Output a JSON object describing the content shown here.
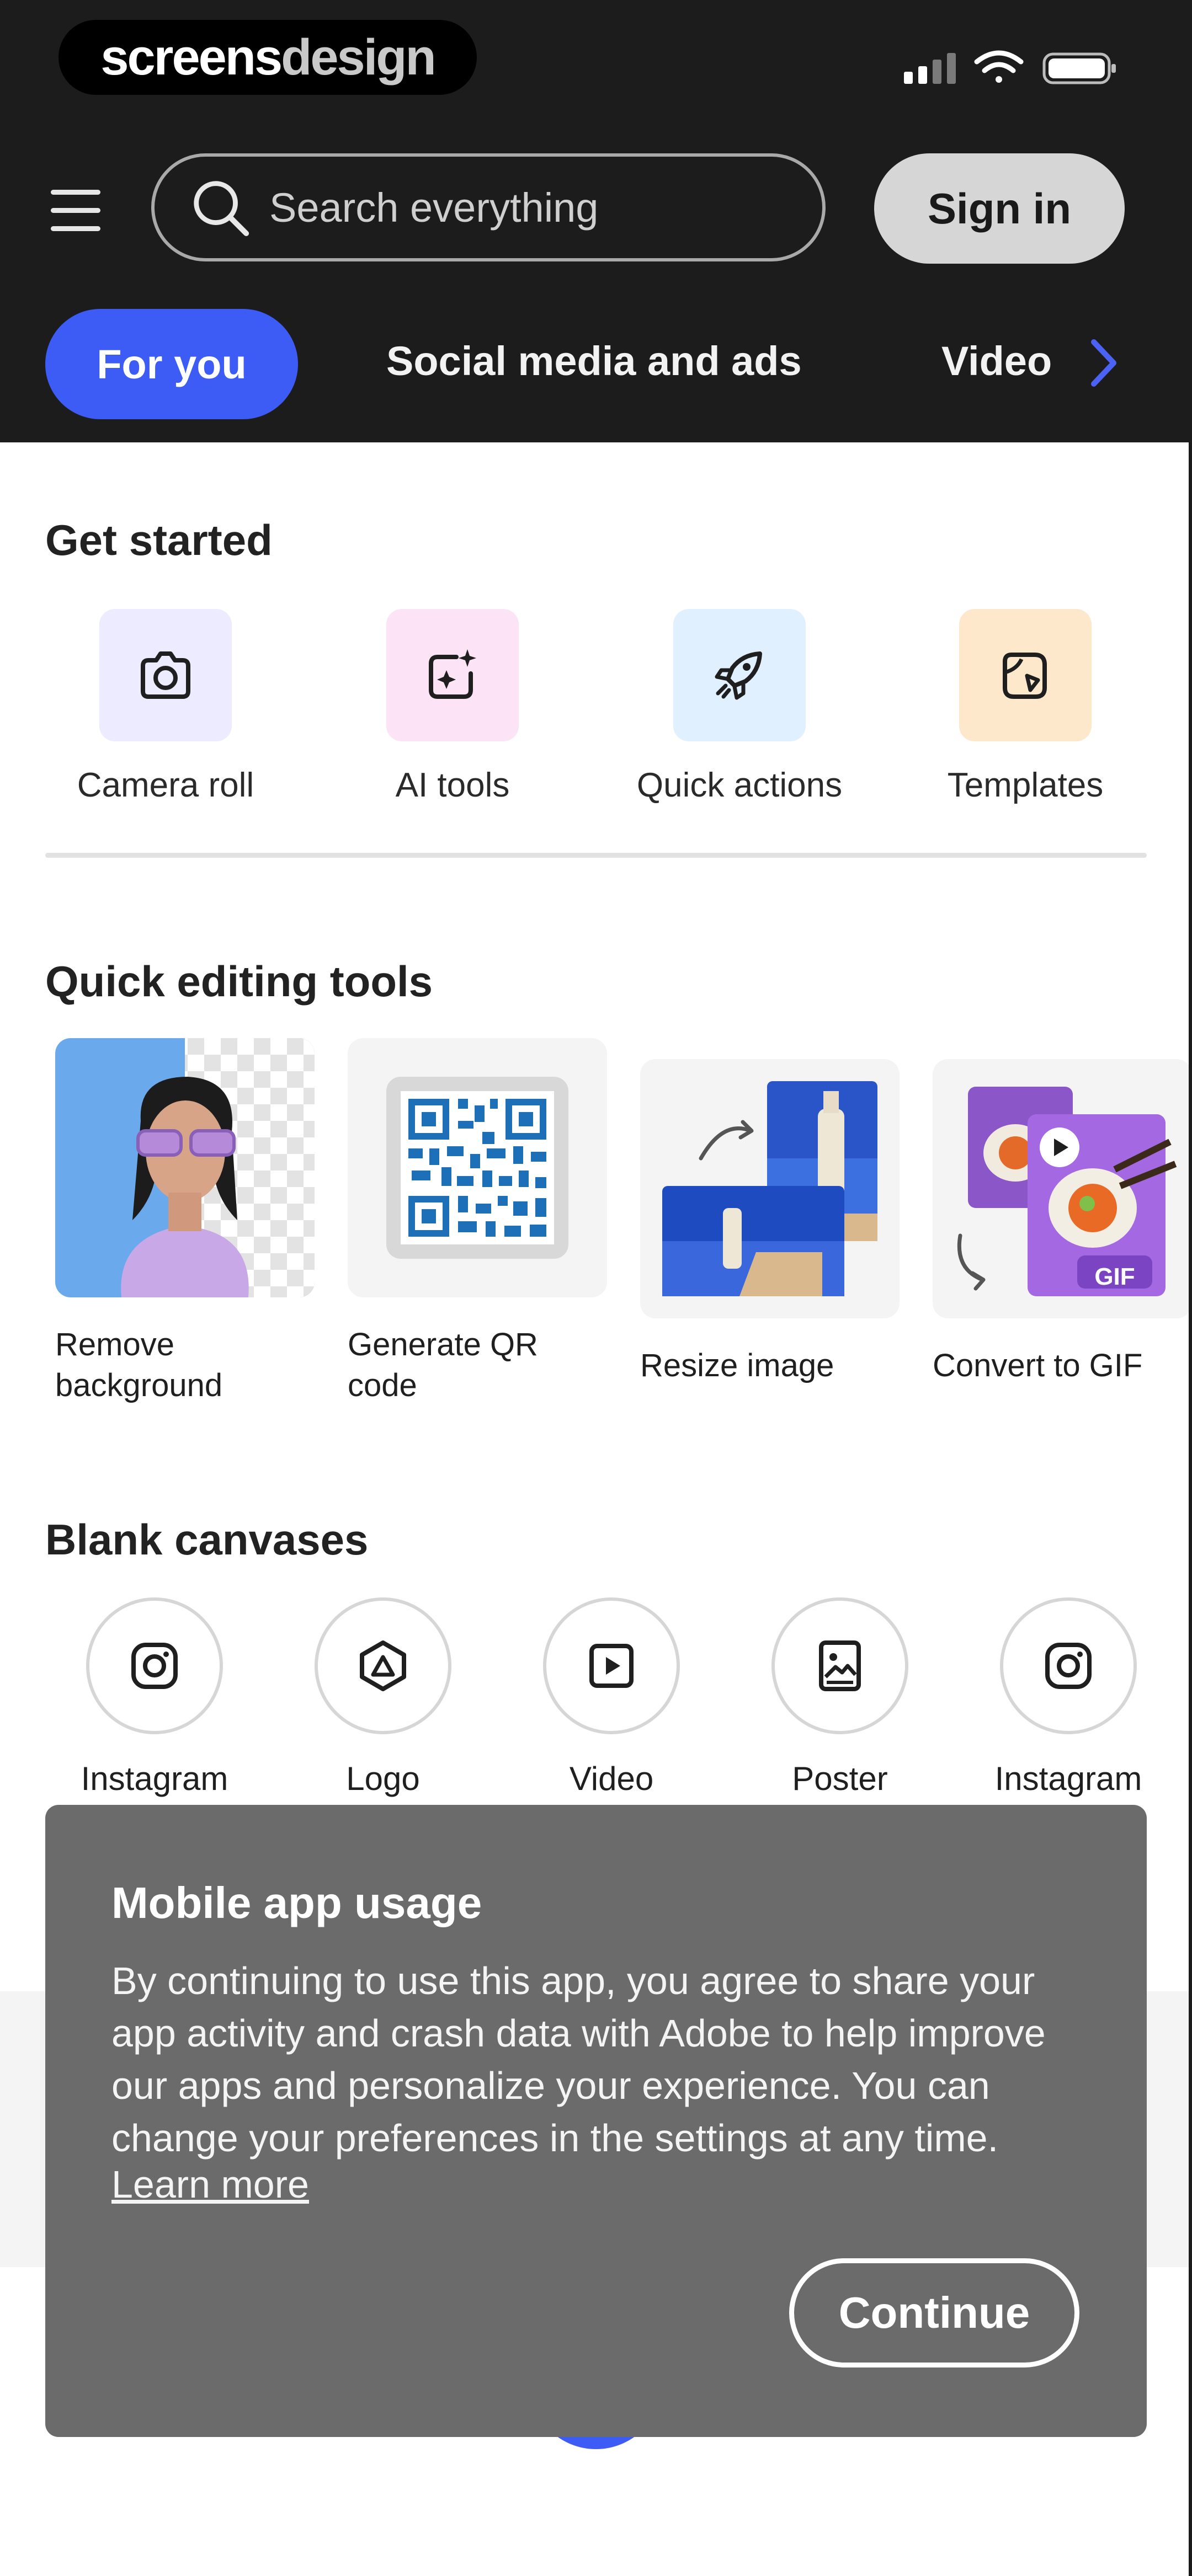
{
  "brand": {
    "part1": "screens",
    "part2": "design"
  },
  "header": {
    "search_placeholder": "Search everything",
    "sign_in": "Sign in",
    "tabs": [
      {
        "label": "For you",
        "active": true
      },
      {
        "label": "Social media and ads",
        "active": false
      },
      {
        "label": "Video",
        "active": false
      }
    ],
    "accent": "#3d5cf5"
  },
  "get_started": {
    "title": "Get started",
    "items": [
      {
        "label": "Camera roll",
        "icon": "camera-icon",
        "bg": "#ecebff"
      },
      {
        "label": "AI tools",
        "icon": "ai-sparkle-icon",
        "bg": "#fde3f6"
      },
      {
        "label": "Quick actions",
        "icon": "rocket-icon",
        "bg": "#e1f0ff"
      },
      {
        "label": "Templates",
        "icon": "templates-icon",
        "bg": "#fde8cc"
      }
    ]
  },
  "quick_editing": {
    "title": "Quick editing tools",
    "items": [
      {
        "label": "Remove background"
      },
      {
        "label": "Generate QR code"
      },
      {
        "label": "Resize image"
      },
      {
        "label": "Convert to GIF",
        "badge": "GIF"
      }
    ]
  },
  "blank_canvases": {
    "title": "Blank canvases",
    "items": [
      {
        "label": "Instagram",
        "icon": "instagram-icon"
      },
      {
        "label": "Logo",
        "icon": "logo-icon"
      },
      {
        "label": "Video",
        "icon": "video-icon"
      },
      {
        "label": "Poster",
        "icon": "poster-icon"
      },
      {
        "label": "Instagram",
        "icon": "instagram-icon"
      }
    ]
  },
  "modal": {
    "title": "Mobile app usage",
    "body": "By continuing to use this app, you agree to share your app activity and crash data with Adobe to help improve our apps and personalize your experience.  You can change your preferences in the settings at any time.",
    "learn_more": "Learn more",
    "continue": "Continue"
  }
}
